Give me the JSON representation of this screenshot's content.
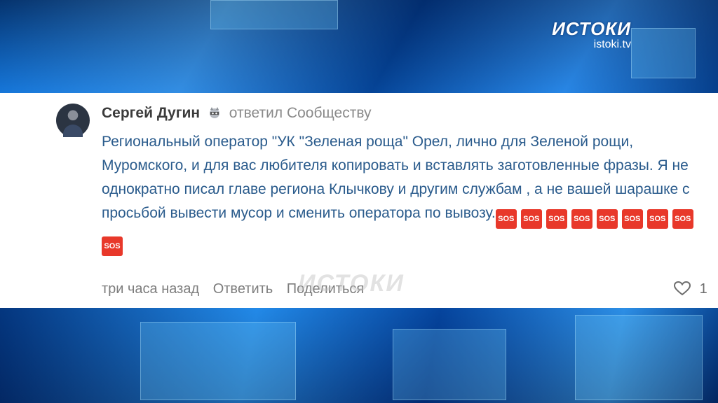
{
  "logo": {
    "text": "ИСТОКИ",
    "url": "istoki.tv"
  },
  "comment": {
    "author": "Сергей Дугин",
    "author_badge_icon": "raccoon-icon",
    "replied_to": "ответил Сообществу",
    "text": "Региональный оператор \"УК \"Зеленая роща\" Орел, лично для Зеленой рощи, Муромского, и для вас любителя копировать и вставлять заготовленные фразы. Я не однократно писал главе региона Клычкову и другим службам , а не вашей шарашке с просьбой вывести мусор и сменить оператора по вывозу.",
    "emoji_label": "SOS",
    "emoji_count": 9,
    "time": "три часа назад",
    "reply_label": "Ответить",
    "share_label": "Поделиться",
    "likes": "1"
  },
  "watermark": "ИСТОКИ",
  "colors": {
    "text_blue": "#2a5b8c",
    "sos_red": "#e8382a",
    "bg_blue": "#0a63c4"
  }
}
